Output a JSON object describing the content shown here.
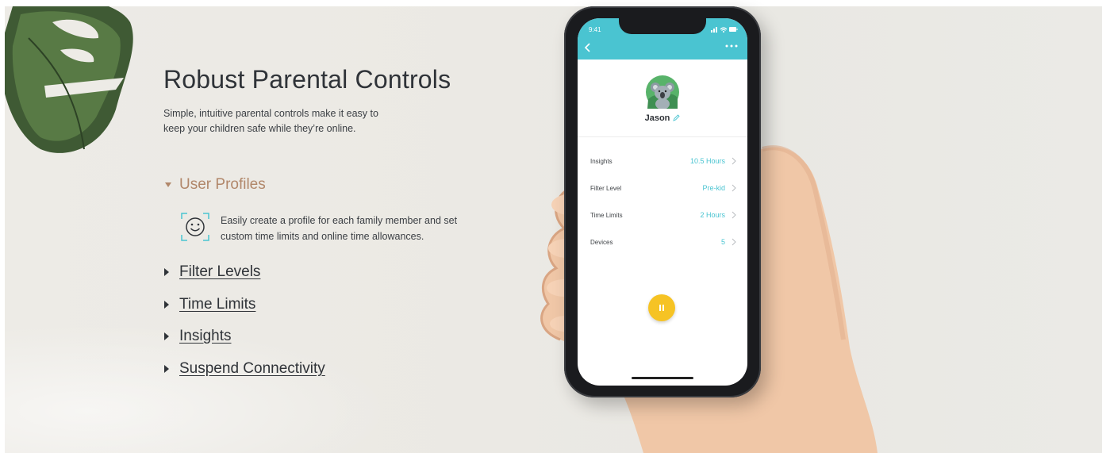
{
  "hero": {
    "title": "Robust Parental Controls",
    "subtitle": "Simple, intuitive parental controls make it easy to keep your children safe while they’re online."
  },
  "features": {
    "open_item": {
      "label": "User Profiles",
      "description": "Easily create a profile for each family member and set custom time limits and online time allowances.",
      "icon": "smiley-face-icon"
    },
    "collapsed_items": [
      {
        "label": "Filter Levels"
      },
      {
        "label": "Time Limits"
      },
      {
        "label": "Insights"
      },
      {
        "label": "Suspend Connectivity"
      }
    ]
  },
  "phone": {
    "status_time": "9:41",
    "profile_name": "Jason",
    "rows": [
      {
        "label": "Insights",
        "value": "10.5 Hours"
      },
      {
        "label": "Filter Level",
        "value": "Pre-kid"
      },
      {
        "label": "Time Limits",
        "value": "2 Hours"
      },
      {
        "label": "Devices",
        "value": "5"
      }
    ]
  },
  "colors": {
    "accent_teal": "#4ac4d1",
    "accent_tan": "#b1876a",
    "pause_yellow": "#f6c324",
    "text_dark": "#2f3338"
  }
}
